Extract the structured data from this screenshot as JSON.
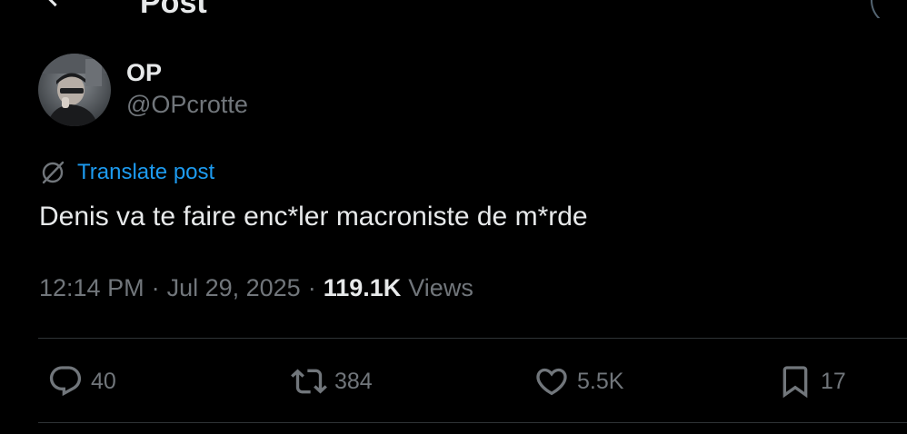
{
  "header": {
    "title": "Post",
    "back_icon": "arrow-left-icon"
  },
  "author": {
    "display_name": "OP",
    "handle": "@OPcrotte",
    "avatar_icon": "user-avatar"
  },
  "translate": {
    "label": "Translate post",
    "icon": "globe-translate-icon"
  },
  "post": {
    "text": "Denis va te faire enc*ler macroniste de m*rde"
  },
  "meta": {
    "time": "12:14 PM",
    "separator": "·",
    "date": "Jul 29, 2025",
    "views_count": "119.1K",
    "views_label": "Views"
  },
  "actions": {
    "reply": {
      "count": "40",
      "icon": "reply-bubble-icon"
    },
    "repost": {
      "count": "384",
      "icon": "repost-arrows-icon"
    },
    "like": {
      "count": "5.5K",
      "icon": "heart-icon"
    },
    "bookmark": {
      "count": "17",
      "icon": "bookmark-icon"
    }
  },
  "colors": {
    "background": "#000000",
    "primary_text": "#e7e9ea",
    "secondary_text": "#71767b",
    "link": "#1d9bf0",
    "divider": "#2f3336"
  }
}
